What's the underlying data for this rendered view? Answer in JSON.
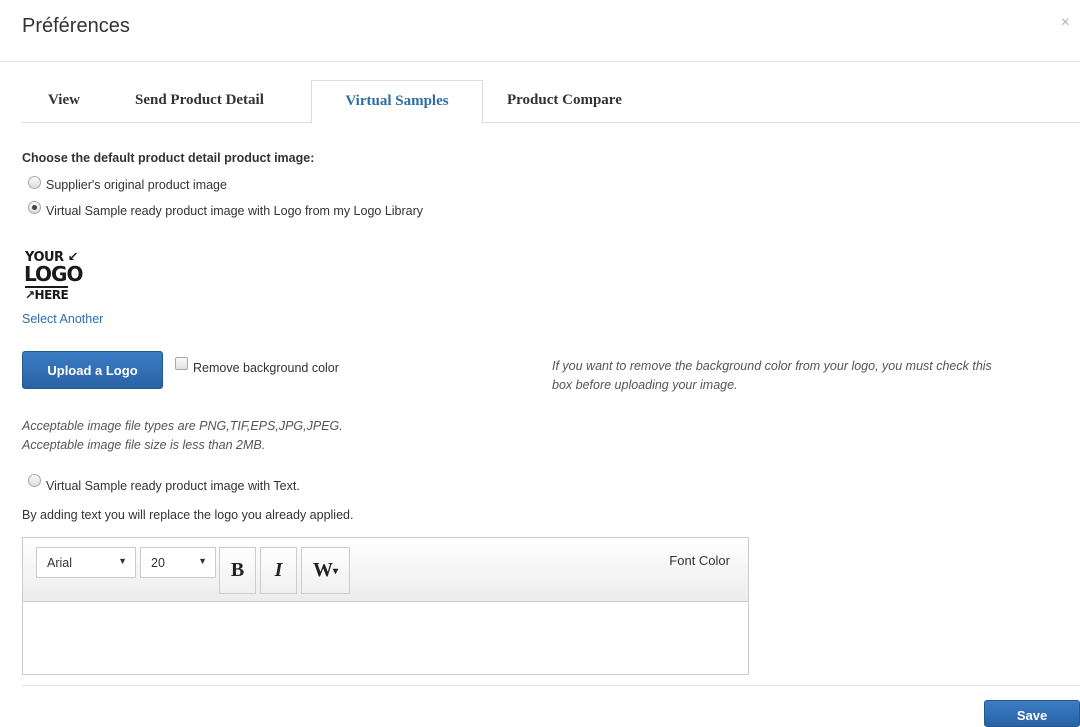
{
  "header": {
    "title": "Préférences",
    "close_label": "×"
  },
  "tabs": [
    {
      "label": "View",
      "active": false
    },
    {
      "label": "Send Product Detail",
      "active": false
    },
    {
      "label": "Virtual Samples",
      "active": true
    },
    {
      "label": "Product Compare",
      "active": false
    }
  ],
  "image_choice": {
    "heading": "Choose the default product detail product image:",
    "option_original": "Supplier's original product image",
    "option_logo": "Virtual Sample ready product image with Logo from my Logo Library",
    "selected": "option_logo"
  },
  "logo": {
    "line1": "YOUR ↙",
    "line2": "LOGO",
    "line3": "↗HERE",
    "select_another": "Select Another"
  },
  "upload": {
    "button_label": "Upload a Logo",
    "remove_bg_label": "Remove background color",
    "remove_bg_checked": false,
    "hint_line1": "If you want to remove the background color from your logo, you must check this",
    "hint_line2": "box before uploading your image.",
    "file_types": "Acceptable image file types are PNG,TIF,EPS,JPG,JPEG.",
    "file_size": "Acceptable image file size is less than 2MB."
  },
  "text_option": {
    "label": "Virtual Sample ready product image with Text.",
    "note": "By adding text you will replace the logo you already applied."
  },
  "editor": {
    "font": "Arial",
    "size": "20",
    "bold_label": "B",
    "italic_label": "I",
    "wrap_label": "W",
    "font_color_label": "Font Color",
    "text_value": ""
  },
  "footer": {
    "save_label": "Save"
  },
  "colors": {
    "accent": "#2a62a6",
    "link": "#2a6db0",
    "active_tab": "#2e6da4"
  }
}
